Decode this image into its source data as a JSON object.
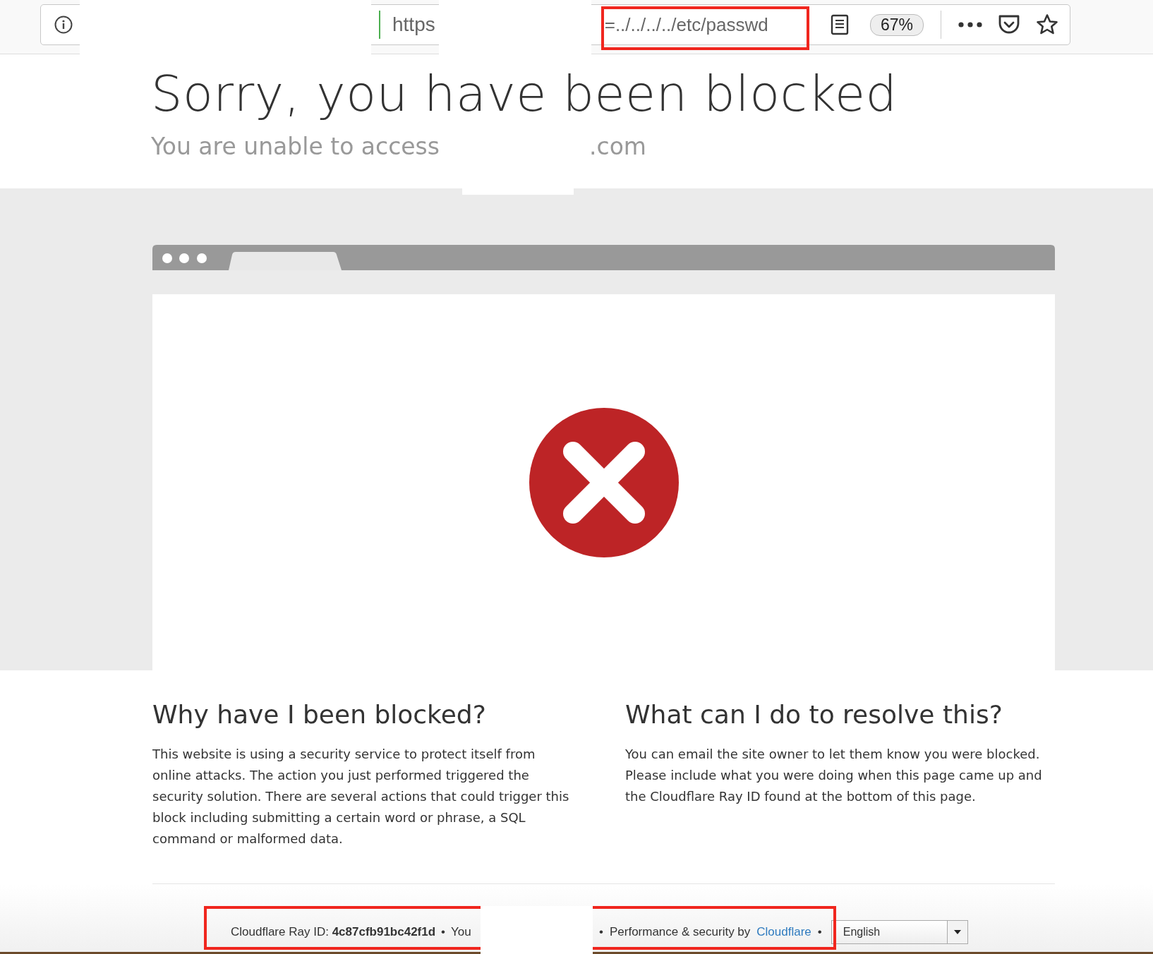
{
  "toolbar": {
    "url_scheme": "https",
    "url_tail": "=../../../../etc/passwd",
    "zoom": "67%"
  },
  "header": {
    "title": "Sorry, you have been blocked",
    "subtitle_start": "You are unable to access",
    "subtitle_end": ".com"
  },
  "sections": [
    {
      "title": "Why have I been blocked?",
      "text": "This website is using a security service to protect itself from online attacks. The action you just performed triggered the security solution. There are several actions that could trigger this block including submitting a certain word or phrase, a SQL command or malformed data."
    },
    {
      "title": "What can I do to resolve this?",
      "text": "You can email the site owner to let them know you were blocked. Please include what you were doing when this page came up and the Cloudflare Ray ID found at the bottom of this page."
    }
  ],
  "footer": {
    "ray_id": "Cloudflare Ray ID: **4c87cfb91bc42f1d**",
    "separator_1": "•",
    "ip_fragment": "You",
    "separator_2": "•",
    "performance": "Performance & security by",
    "provider_link": "Cloudflare",
    "separator_3": "•",
    "language": "English"
  }
}
